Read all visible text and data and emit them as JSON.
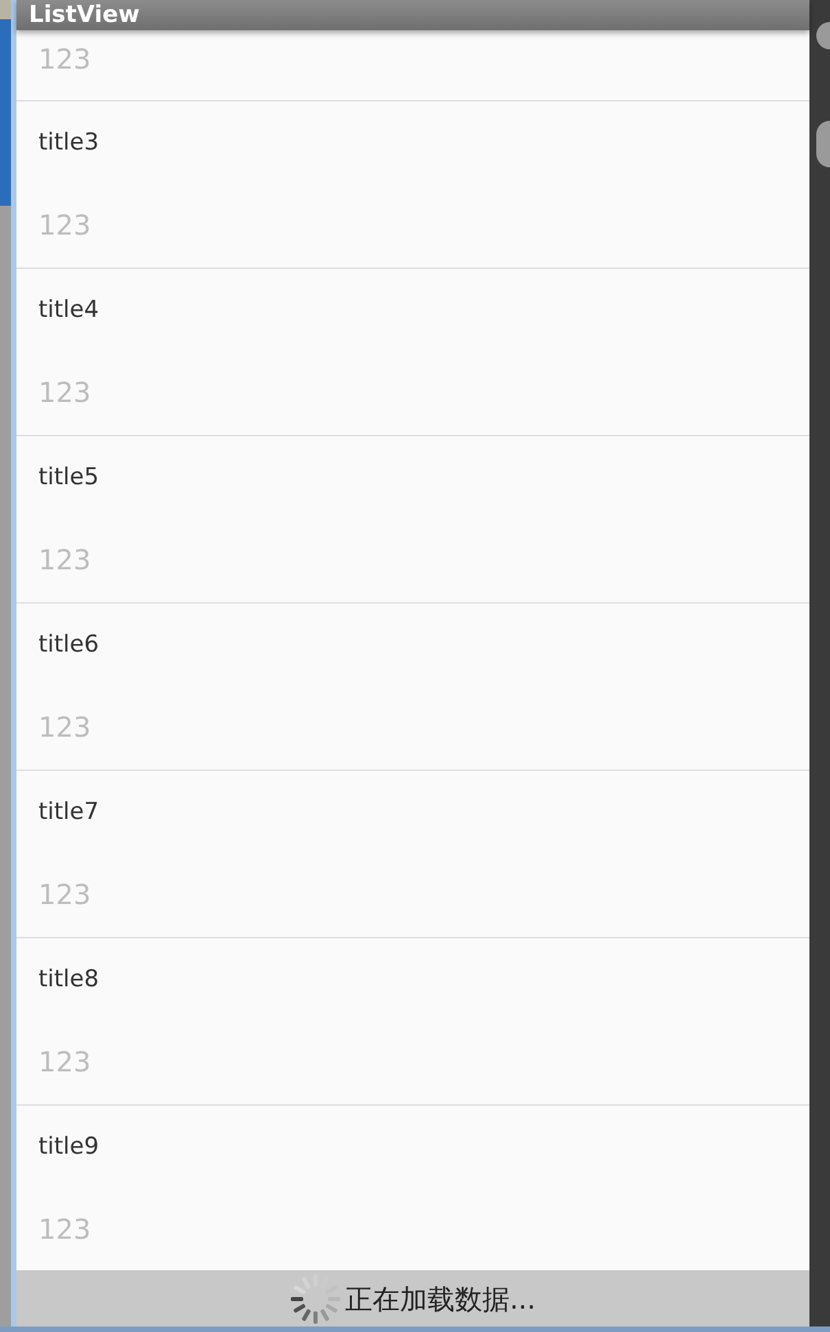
{
  "app_bar": {
    "title": "ListView"
  },
  "list": {
    "items": [
      {
        "subtitle": "123"
      },
      {
        "title": "title3",
        "subtitle": "123"
      },
      {
        "title": "title4",
        "subtitle": "123"
      },
      {
        "title": "title5",
        "subtitle": "123"
      },
      {
        "title": "title6",
        "subtitle": "123"
      },
      {
        "title": "title7",
        "subtitle": "123"
      },
      {
        "title": "title8",
        "subtitle": "123"
      },
      {
        "title": "title9",
        "subtitle": "123"
      }
    ]
  },
  "loading_footer": {
    "text": "正在加载数据..."
  }
}
